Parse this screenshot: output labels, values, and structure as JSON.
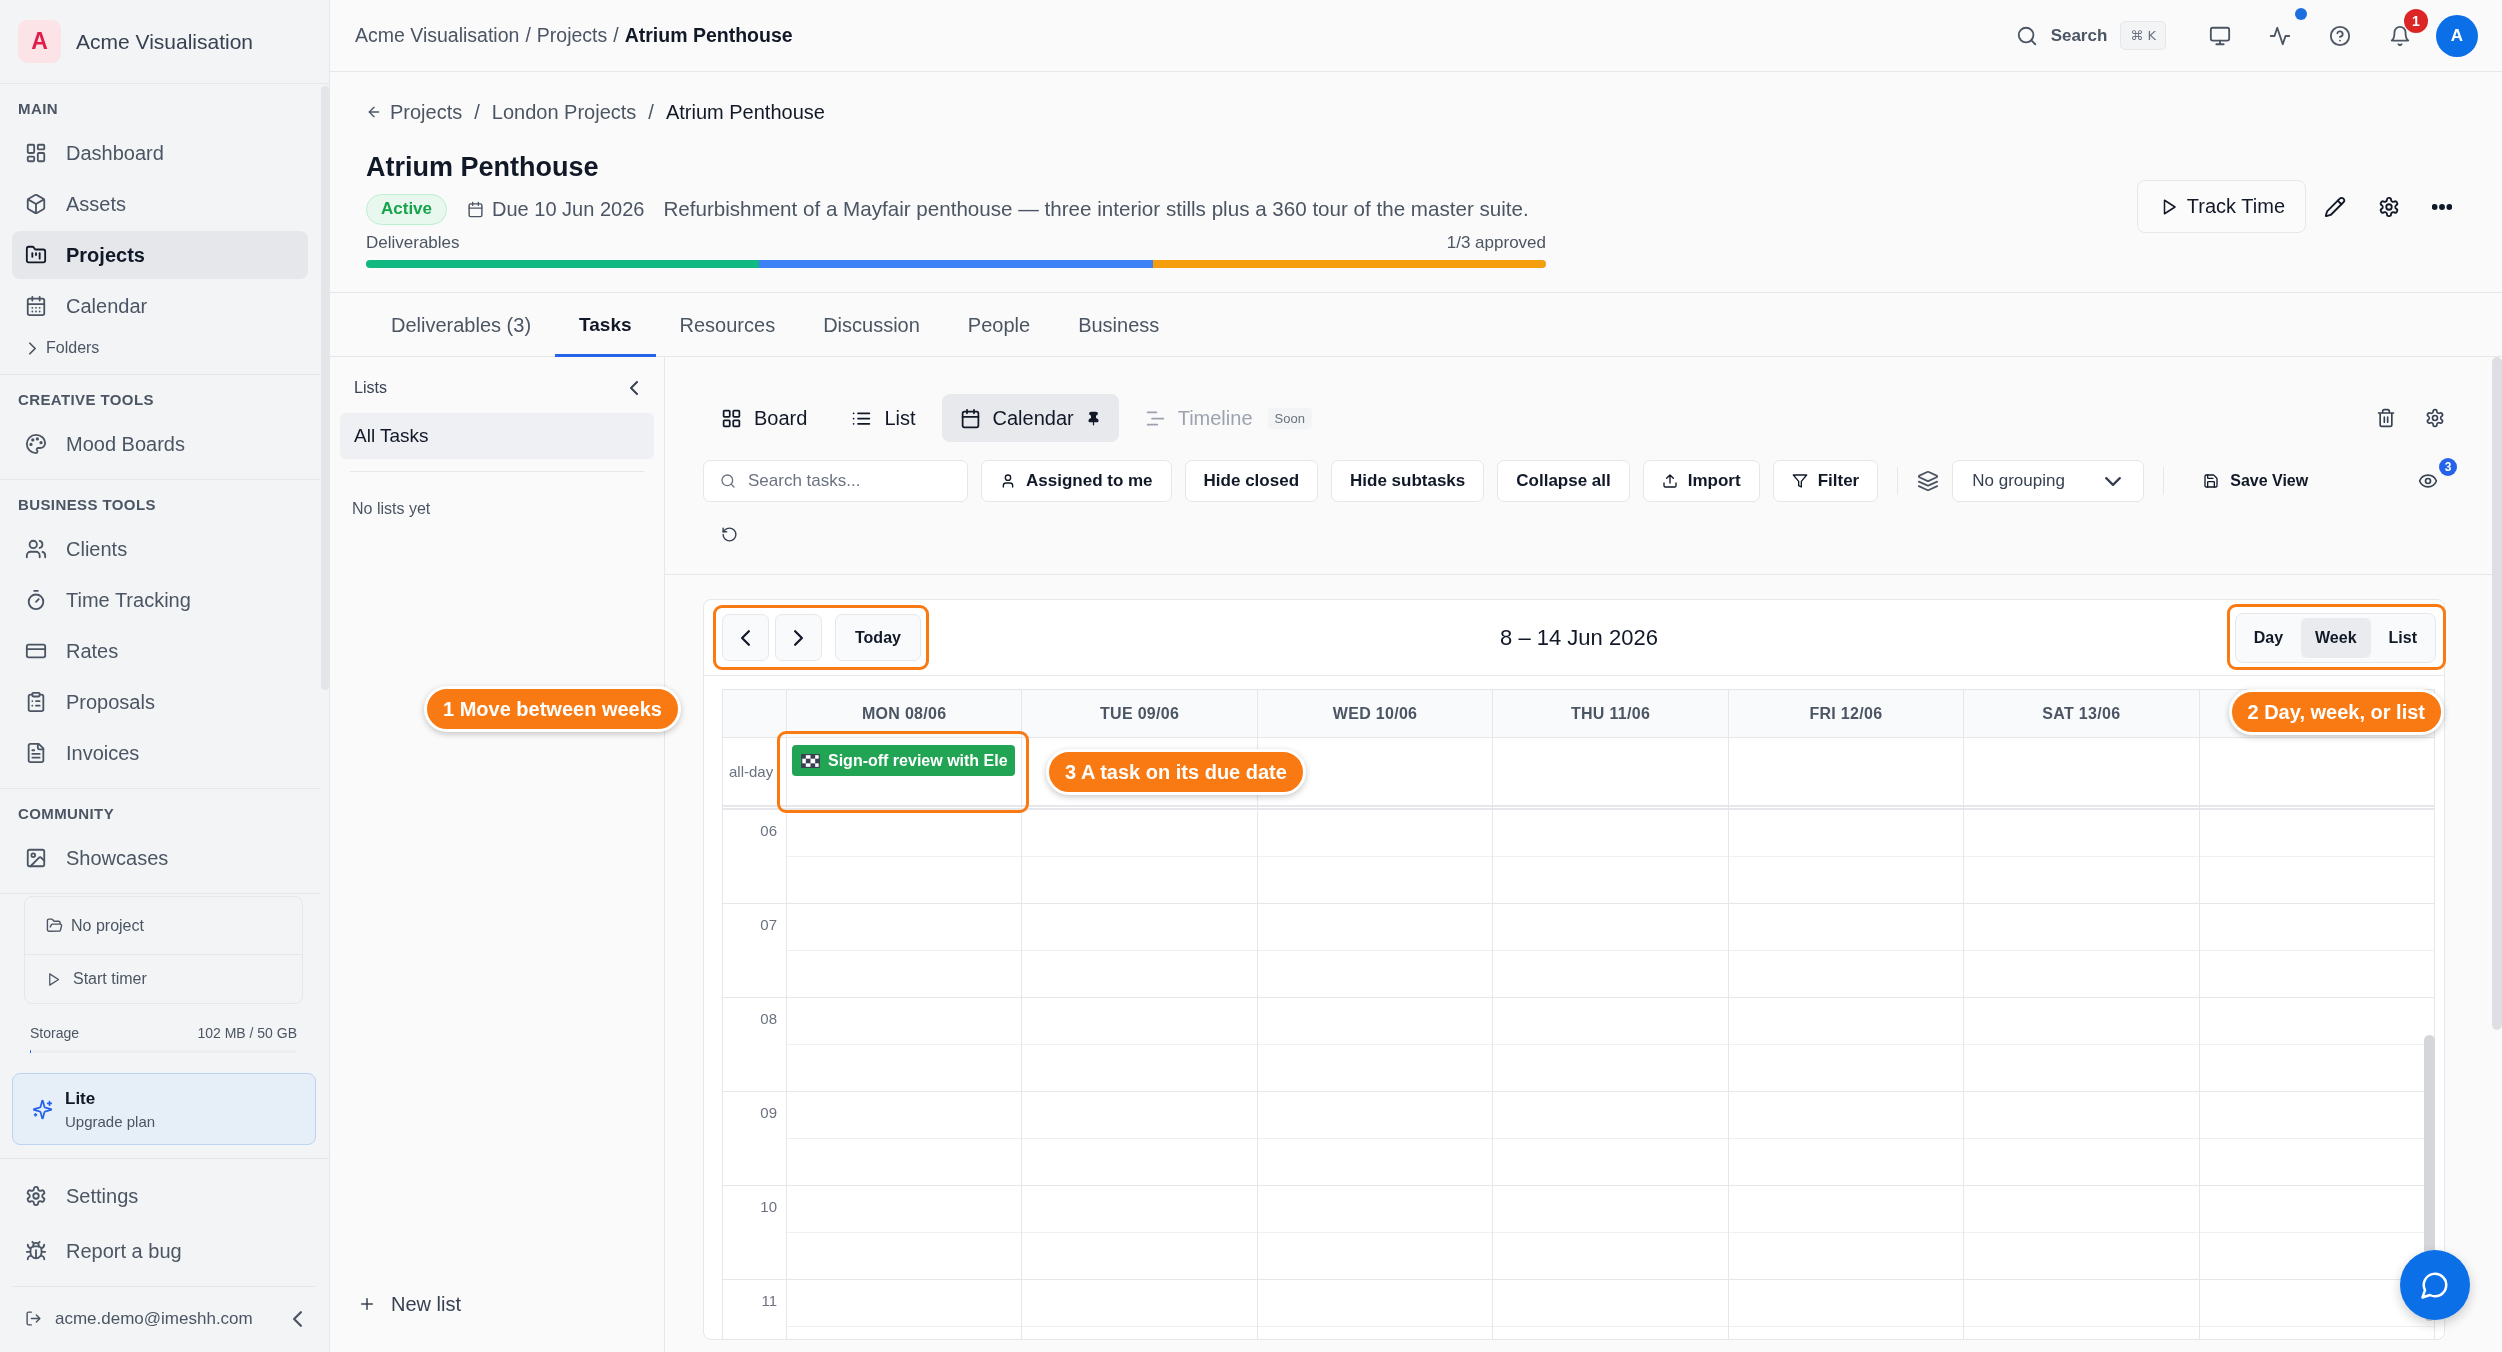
{
  "sidebar": {
    "brand": {
      "initial": "A",
      "name": "Acme Visualisation"
    },
    "sections": [
      {
        "heading": "MAIN",
        "items": [
          {
            "label": "Dashboard",
            "selected": false
          },
          {
            "label": "Assets",
            "selected": false
          },
          {
            "label": "Projects",
            "selected": true
          },
          {
            "label": "Calendar",
            "selected": false
          }
        ],
        "folders": {
          "label": "Folders",
          "expanded": false
        }
      },
      {
        "heading": "CREATIVE TOOLS",
        "items": [
          {
            "label": "Mood Boards",
            "selected": false
          }
        ]
      },
      {
        "heading": "BUSINESS TOOLS",
        "items": [
          {
            "label": "Clients",
            "selected": false
          },
          {
            "label": "Time Tracking",
            "selected": false
          },
          {
            "label": "Rates",
            "selected": false
          },
          {
            "label": "Proposals",
            "selected": false
          },
          {
            "label": "Invoices",
            "selected": false
          }
        ]
      },
      {
        "heading": "COMMUNITY",
        "items": [
          {
            "label": "Showcases",
            "selected": false
          }
        ]
      }
    ],
    "timer": {
      "project": "No project",
      "action": "Start timer"
    },
    "storage": {
      "label": "Storage",
      "usage": "102 MB / 50 GB",
      "level": 0.002
    },
    "plan": {
      "name": "Lite",
      "action": "Upgrade plan"
    },
    "footer_items": [
      {
        "label": "Settings",
        "selected": false
      },
      {
        "label": "Report a bug",
        "selected": false
      }
    ],
    "account": {
      "email": "acme.demo@imeshh.com"
    }
  },
  "topbar": {
    "breadcrumb": {
      "items": [
        "Acme Visualisation",
        "Projects",
        "Atrium Penthouse"
      ],
      "separator": "/"
    },
    "search": {
      "label": "Search",
      "shortcut": "⌘ K"
    },
    "activity_unread": true,
    "notifications": {
      "count": "1"
    },
    "avatar": {
      "initial": "A"
    }
  },
  "project": {
    "breadcrumb": {
      "items": [
        "Projects",
        "London Projects",
        "Atrium Penthouse"
      ],
      "separator": "/"
    },
    "title": "Atrium Penthouse",
    "status": "Active",
    "due": "Due 10 Jun 2026",
    "description": "Refurbishment of a Mayfair penthouse — three interior stills plus a 360 tour of the master suite.",
    "deliverables": {
      "label": "Deliverables",
      "summary": "1/3 approved",
      "segments": [
        {
          "color": "#10b981"
        },
        {
          "color": "#3b82f6"
        },
        {
          "color": "#f59e0b"
        }
      ]
    },
    "actions": {
      "track_time": "Track Time"
    }
  },
  "tabs": [
    {
      "label": "Deliverables (3)",
      "selected": false
    },
    {
      "label": "Tasks",
      "selected": true
    },
    {
      "label": "Resources",
      "selected": false
    },
    {
      "label": "Discussion",
      "selected": false
    },
    {
      "label": "People",
      "selected": false
    },
    {
      "label": "Business",
      "selected": false
    }
  ],
  "lists_panel": {
    "title": "Lists",
    "items": [
      {
        "label": "All Tasks",
        "selected": true
      }
    ],
    "empty_text": "No lists yet",
    "new_list": "New list"
  },
  "tasks": {
    "views": [
      {
        "label": "Board",
        "selected": false,
        "pinned": false,
        "disabled": false
      },
      {
        "label": "List",
        "selected": false,
        "pinned": false,
        "disabled": false
      },
      {
        "label": "Calendar",
        "selected": true,
        "pinned": true,
        "disabled": false
      },
      {
        "label": "Timeline",
        "selected": false,
        "pinned": false,
        "disabled": true,
        "badge": "Soon"
      }
    ],
    "toolbar": {
      "search": {
        "placeholder": "Search tasks..."
      },
      "buttons": [
        {
          "label": "Assigned to me"
        },
        {
          "label": "Hide closed"
        },
        {
          "label": "Hide subtasks"
        },
        {
          "label": "Collapse all"
        },
        {
          "label": "Import"
        },
        {
          "label": "Filter"
        }
      ],
      "grouping": "No grouping",
      "save_view": "Save View",
      "hidden_count": "3"
    }
  },
  "calendar": {
    "nav": {
      "today": "Today"
    },
    "title": "8 – 14 Jun 2026",
    "modes": [
      {
        "label": "Day",
        "selected": false
      },
      {
        "label": "Week",
        "selected": true
      },
      {
        "label": "List",
        "selected": false
      }
    ],
    "all_day_label": "all-day",
    "days": [
      {
        "label": "MON 08/06",
        "events": [
          {
            "title": "Sign-off review with Ele"
          }
        ]
      },
      {
        "label": "TUE 09/06"
      },
      {
        "label": "WED 10/06"
      },
      {
        "label": "THU 11/06"
      },
      {
        "label": "FRI 12/06"
      },
      {
        "label": "SAT 13/06"
      }
    ],
    "hours": [
      "06",
      "07",
      "08",
      "09",
      "10",
      "11"
    ],
    "callouts": [
      "1 Move between weeks",
      "2 Day, week, or list",
      "3 A task on its due date"
    ]
  }
}
